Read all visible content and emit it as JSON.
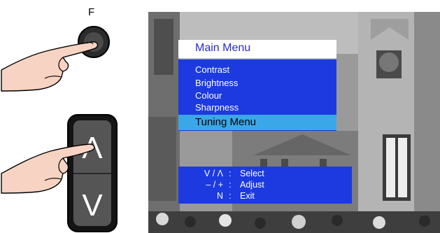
{
  "remote": {
    "f_key_label": "F",
    "rocker_up_glyph": "Λ",
    "rocker_down_glyph": "V"
  },
  "osd": {
    "title": "Main Menu",
    "items": [
      {
        "label": "Contrast"
      },
      {
        "label": "Brightness"
      },
      {
        "label": "Colour"
      },
      {
        "label": "Sharpness"
      }
    ],
    "selected_item": "Tuning Menu",
    "help": [
      {
        "keys": "V / Λ",
        "action": "Select"
      },
      {
        "keys": "– / +",
        "action": "Adjust"
      },
      {
        "keys": "N",
        "action": "Exit"
      }
    ],
    "colon": ":"
  },
  "colors": {
    "menu_blue": "#1c3ae0",
    "highlight": "#3aa8e8",
    "title_text": "#2a2ad0"
  },
  "icons": [
    "round-f-button-icon",
    "pointing-hand-icon",
    "up-down-rocker-icon"
  ]
}
